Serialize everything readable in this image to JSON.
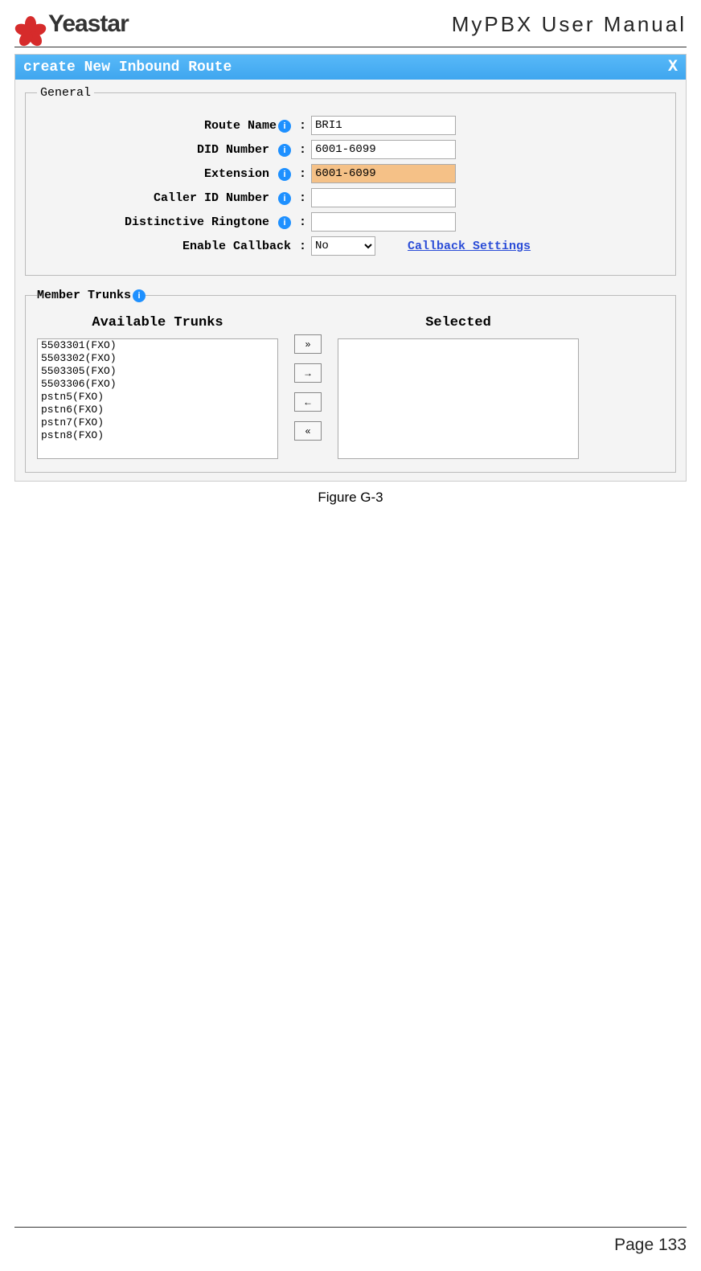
{
  "header": {
    "brand": "Yeastar",
    "doc_title": "MyPBX User Manual"
  },
  "modal": {
    "title": "create New Inbound Route",
    "close": "X"
  },
  "general": {
    "legend": "General",
    "route_name": {
      "label": "Route Name",
      "value": "BRI1"
    },
    "did_number": {
      "label": "DID Number",
      "value": "6001-6099"
    },
    "extension": {
      "label": "Extension",
      "value": "6001-6099"
    },
    "caller_id": {
      "label": "Caller ID Number",
      "value": ""
    },
    "ringtone": {
      "label": "Distinctive Ringtone",
      "value": ""
    },
    "callback": {
      "label": "Enable Callback",
      "value": "No",
      "link": "Callback Settings"
    }
  },
  "trunks": {
    "legend": "Member Trunks",
    "avail_title": "Available Trunks",
    "sel_title": "Selected",
    "available": [
      "5503301(FXO)",
      "5503302(FXO)",
      "5503305(FXO)",
      "5503306(FXO)",
      "pstn5(FXO)",
      "pstn6(FXO)",
      "pstn7(FXO)",
      "pstn8(FXO)"
    ],
    "selected": [],
    "btn_all_right": "»",
    "btn_right": "→",
    "btn_left": "←",
    "btn_all_left": "«"
  },
  "caption": "Figure G-3",
  "footer": {
    "page": "Page 133"
  }
}
